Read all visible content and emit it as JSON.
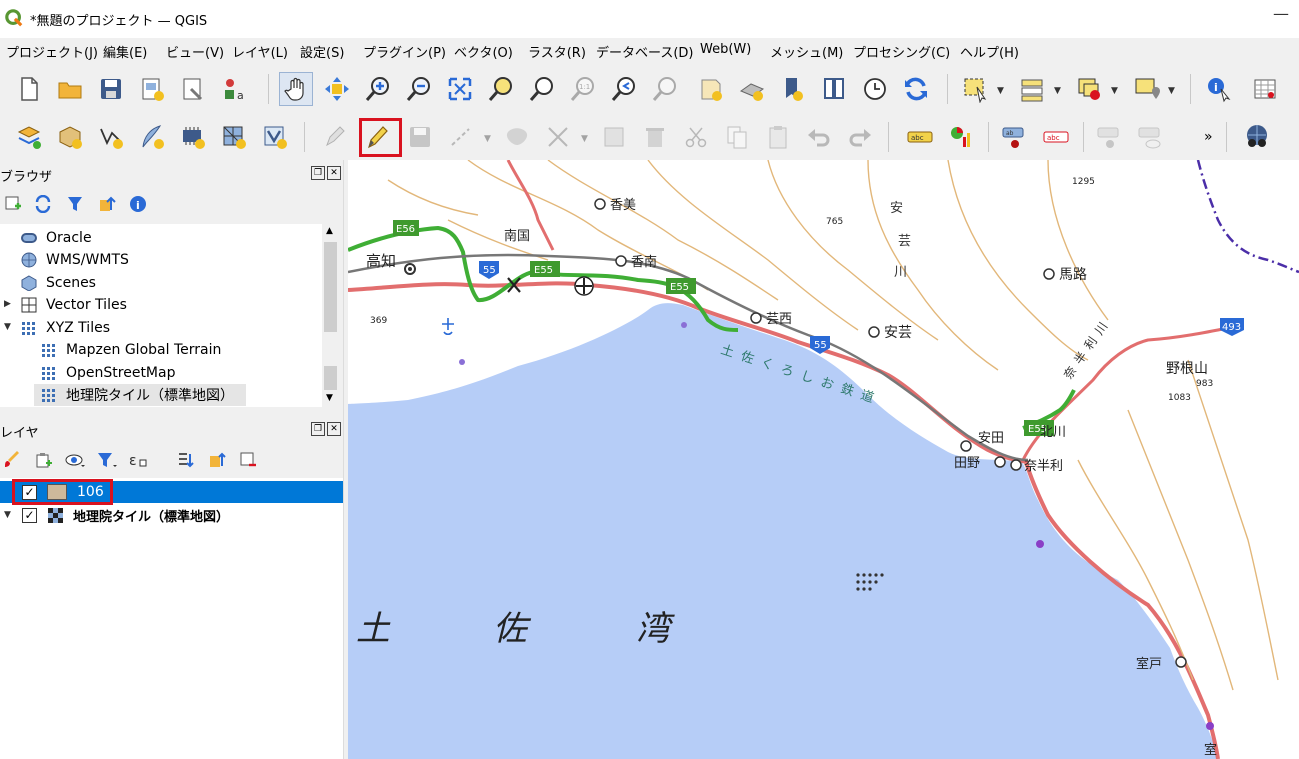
{
  "window": {
    "title": "*無題のプロジェクト — QGIS",
    "minimize": "—"
  },
  "menu": [
    "プロジェクト(J)",
    "編集(E)",
    "ビュー(V)",
    "レイヤ(L)",
    "設定(S)",
    "プラグイン(P)",
    "ベクタ(O)",
    "ラスタ(R)",
    "データベース(D)",
    "Web(W)",
    "メッシュ(M)",
    "プロセシング(C)",
    "ヘルプ(H)"
  ],
  "toolbar": {
    "overflow": "»"
  },
  "browser": {
    "title": "ブラウザ",
    "items": [
      {
        "label": "Oracle"
      },
      {
        "label": "WMS/WMTS"
      },
      {
        "label": "Scenes"
      },
      {
        "label": "Vector Tiles"
      },
      {
        "label": "XYZ Tiles"
      },
      {
        "label": "Mapzen Global Terrain"
      },
      {
        "label": "OpenStreetMap"
      },
      {
        "label": "地理院タイル（標準地図）"
      }
    ]
  },
  "layers": {
    "title": "レイヤ",
    "items": [
      {
        "label": "106",
        "checked": true,
        "selected": true
      },
      {
        "label": "地理院タイル（標準地図）",
        "checked": true,
        "selected": false
      }
    ]
  },
  "map": {
    "labels": {
      "kochi": "高知",
      "nankoku": "南国",
      "kami": "香美",
      "konan": "香南",
      "geisei": "芸西",
      "aki": "安芸",
      "umaji": "馬路",
      "yasuda": "安田",
      "tano": "田野",
      "kitagawa": "北川",
      "nahari": "奈半利",
      "unoyama": "野根山",
      "muroto": "室戸",
      "muro": "室",
      "tosa1": "土",
      "tosa2": "佐",
      "wan": "湾",
      "aki_kawa1": "安",
      "aki_kawa2": "芸",
      "aki_kawa3": "川",
      "coast": "土佐くろしお鉄道",
      "nahari_kawa": "奈半利川",
      "h1295": "1295",
      "h765": "765",
      "h369": "369",
      "h983": "983",
      "h1083": "1083",
      "r55a": "55",
      "r55b": "55",
      "r493": "493",
      "e56": "E56",
      "e55a": "E55",
      "e55b": "E55",
      "e55c": "E55"
    },
    "colors": {
      "sea": "#b6cdf7",
      "land": "#ffffff",
      "contour": "#e2b77a",
      "coast_road": "#e26e6e",
      "expressway": "#3fae35",
      "route": "#2a6ad6"
    }
  }
}
